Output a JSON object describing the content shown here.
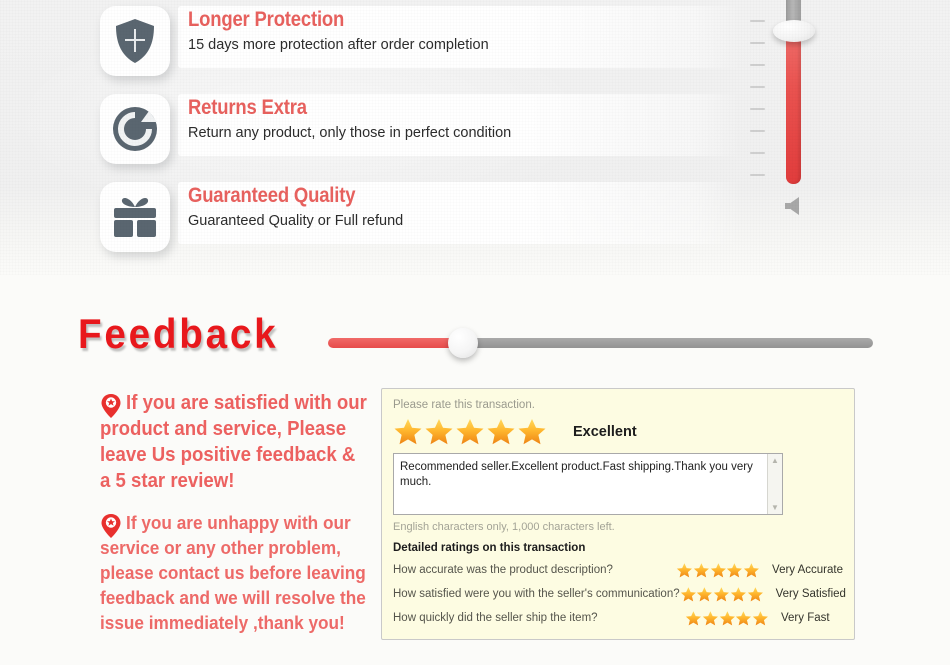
{
  "service_banner": {
    "features": [
      {
        "icon": "shield-icon",
        "title": "Longer Protection",
        "description": "15 days more protection after order completion"
      },
      {
        "icon": "refresh-return-icon",
        "title": "Returns Extra",
        "description": "Return any product, only those in perfect condition"
      },
      {
        "icon": "gift-icon",
        "title": "Guaranteed Quality",
        "description": "Guaranteed Quality or Full refund"
      }
    ]
  },
  "vertical_slider": {
    "name": "volume-slider",
    "tick_count": 9,
    "value_percent": 76,
    "speaker_icon": "speaker-icon"
  },
  "horizontal_slider": {
    "name": "progress-slider",
    "value_percent": 25
  },
  "feedback": {
    "heading": "Feedback",
    "notes": [
      {
        "icon": "location-pin-star-icon",
        "text": "If you are satisfied with our product and service, Please leave Us positive feedback & a 5 star review!"
      },
      {
        "icon": "location-pin-star-icon",
        "text": "If you are unhappy with our service or any other problem, please contact us before leaving feedback and we will resolve the issue immediately ,thank you!"
      }
    ]
  },
  "rating_panel": {
    "prompt": "Please rate this transaction.",
    "star_count": 5,
    "rating_label": "Excellent",
    "comment": "Recommended seller.Excellent product.Fast shipping.Thank you very much.",
    "char_note": "English characters only, 1,000 characters left.",
    "detailed_title": "Detailed ratings on this transaction",
    "detailed_rows": [
      {
        "question": "How accurate was the product description?",
        "stars": 5,
        "answer": "Very Accurate"
      },
      {
        "question": "How satisfied were you with the seller's communication?",
        "stars": 5,
        "answer": "Very Satisfied"
      },
      {
        "question": "How quickly did the seller ship the item?",
        "stars": 5,
        "answer": "Very Fast"
      }
    ],
    "scroll_up_icon": "chevron-up-icon",
    "scroll_down_icon": "chevron-down-icon"
  },
  "colors": {
    "accent_red": "#e8615e",
    "heading_red": "#e8181c",
    "icon_gray": "#5a6670",
    "star_orange": "#f5a623",
    "panel_bg": "#fdfce2"
  }
}
